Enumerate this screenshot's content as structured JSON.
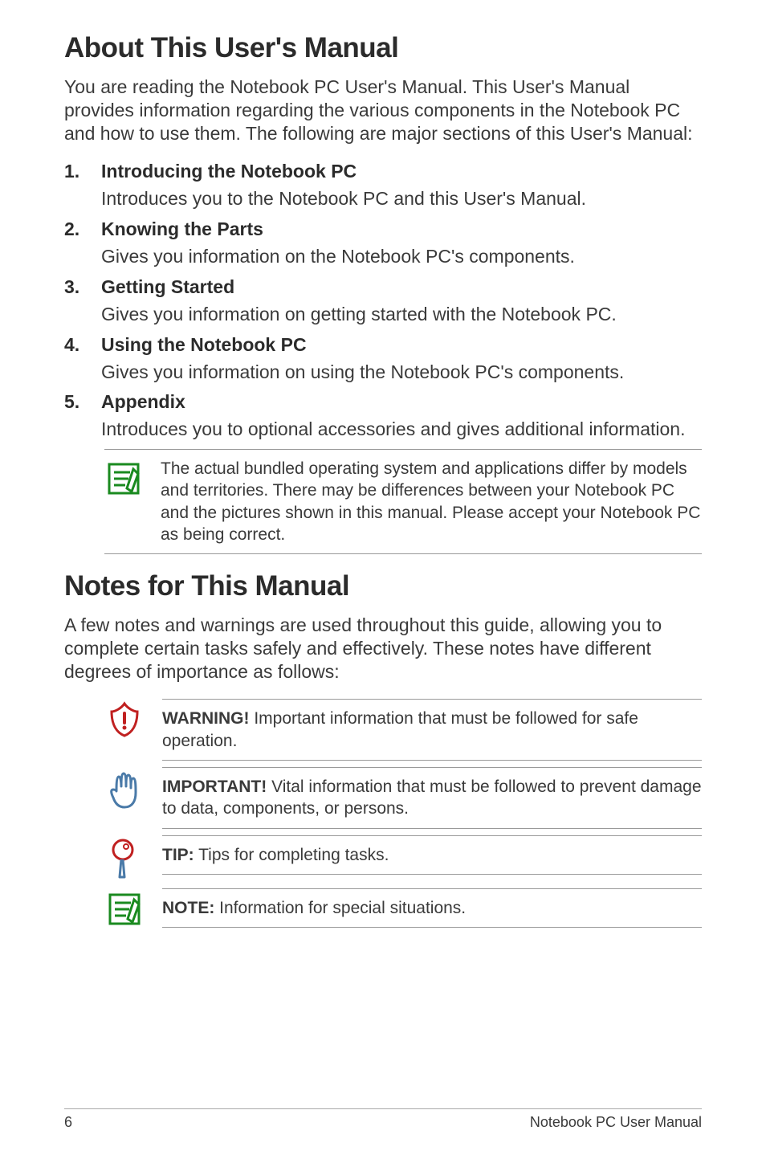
{
  "about": {
    "heading": "About This User's Manual",
    "intro": "You are reading the Notebook PC User's Manual. This User's Manual provides information regarding the various components in the Notebook PC and how to use them. The following are major sections of this User's Manual:",
    "sections": [
      {
        "num": "1.",
        "title": "Introducing the Notebook PC",
        "desc": "Introduces you to the Notebook PC and this User's Manual."
      },
      {
        "num": "2.",
        "title": "Knowing the Parts",
        "desc": "Gives you information on the Notebook PC's components."
      },
      {
        "num": "3.",
        "title": "Getting Started",
        "desc": "Gives you information on getting started with the Notebook PC."
      },
      {
        "num": "4.",
        "title": "Using the Notebook PC",
        "desc": "Gives you information on using the Notebook PC's components."
      },
      {
        "num": "5.",
        "title": "Appendix",
        "desc": "Introduces you to optional accessories and gives additional information."
      }
    ],
    "bundle_note": "The actual bundled operating system and applications differ by models and territories. There may be differences between your Notebook PC and the pictures shown in this manual. Please accept your Notebook PC as being correct."
  },
  "notes": {
    "heading": "Notes for This Manual",
    "intro": "A few notes and warnings are used throughout this guide, allowing you to complete certain tasks safely and effectively. These notes have different degrees of importance as follows:",
    "items": [
      {
        "label": "WARNING!",
        "text": " Important information that must be followed for safe operation."
      },
      {
        "label": "IMPORTANT!",
        "text": " Vital information that must be followed to prevent damage to data, components, or persons."
      },
      {
        "label": "TIP:",
        "text": " Tips for completing tasks."
      },
      {
        "label": "NOTE:",
        "text": "  Information for special situations."
      }
    ]
  },
  "footer": {
    "page": "6",
    "doc": "Notebook PC User Manual"
  }
}
